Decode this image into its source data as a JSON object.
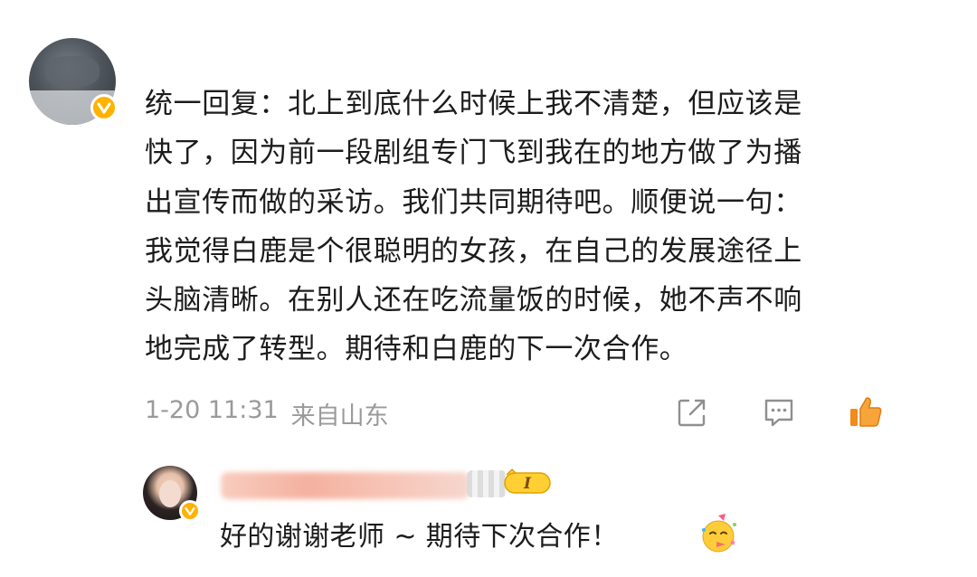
{
  "comment": {
    "lines": [
      "统一回复：北上到底什么时候上我不清楚，但应该是",
      "快了，因为前一段剧组专门飞到我在的地方做了为播",
      "出宣传而做的采访。我们共同期待吧。顺便说一句：",
      "我觉得白鹿是个很聪明的女孩，在自己的发展途径上",
      "头脑清晰。在别人还在吃流量饭的时候，她不声不响",
      "地完成了转型。期待和白鹿的下一次合作。"
    ],
    "timestamp": "1-20 11:31",
    "location": "来自山东"
  },
  "actions": {
    "share_icon": "share-icon",
    "comment_icon": "comment-icon",
    "like_icon": "thumbs-up-icon"
  },
  "reply": {
    "text": "好的谢谢老师 ~ 期待下次合作！",
    "emoji": "party-face-emoji",
    "level_badge_text": "I"
  },
  "colors": {
    "accent": "#ffb200",
    "meta_text": "#9a9a9a",
    "like_orange": "#f28a1c"
  }
}
